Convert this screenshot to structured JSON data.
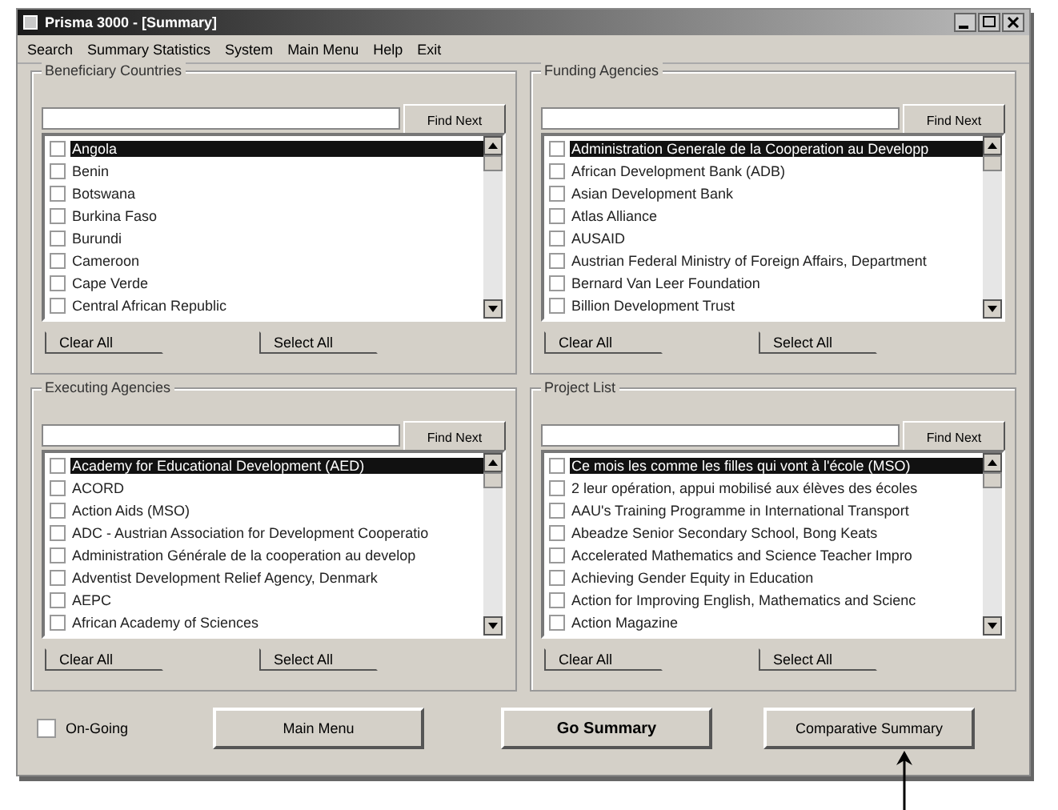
{
  "window": {
    "title": "Prisma 3000 - [Summary]"
  },
  "menu": [
    "Search",
    "Summary Statistics",
    "System",
    "Main Menu",
    "Help",
    "Exit"
  ],
  "groups": [
    {
      "title": "Beneficiary Countries",
      "find_button": "Find Next",
      "clear_button": "Clear All",
      "select_button": "Select All",
      "items": [
        {
          "label": "Angola",
          "checked": false,
          "selected": true
        },
        {
          "label": "Benin",
          "checked": false,
          "selected": false
        },
        {
          "label": "Botswana",
          "checked": false,
          "selected": false
        },
        {
          "label": "Burkina Faso",
          "checked": false,
          "selected": false
        },
        {
          "label": "Burundi",
          "checked": false,
          "selected": false
        },
        {
          "label": "Cameroon",
          "checked": false,
          "selected": false
        },
        {
          "label": "Cape Verde",
          "checked": false,
          "selected": false
        },
        {
          "label": "Central African Republic",
          "checked": false,
          "selected": false
        }
      ]
    },
    {
      "title": "Funding Agencies",
      "find_button": "Find Next",
      "clear_button": "Clear All",
      "select_button": "Select All",
      "items": [
        {
          "label": "Administration Generale de la Cooperation au Developp",
          "checked": false,
          "selected": true
        },
        {
          "label": "African Development Bank (ADB)",
          "checked": false,
          "selected": false
        },
        {
          "label": "Asian Development Bank",
          "checked": false,
          "selected": false
        },
        {
          "label": "Atlas Alliance",
          "checked": false,
          "selected": false
        },
        {
          "label": "AUSAID",
          "checked": false,
          "selected": false
        },
        {
          "label": "Austrian Federal Ministry of Foreign Affairs, Department",
          "checked": false,
          "selected": false
        },
        {
          "label": "Bernard Van Leer Foundation",
          "checked": false,
          "selected": false
        },
        {
          "label": "Billion Development Trust",
          "checked": false,
          "selected": false
        }
      ]
    },
    {
      "title": "Executing Agencies",
      "find_button": "Find Next",
      "clear_button": "Clear All",
      "select_button": "Select All",
      "items": [
        {
          "label": "Academy for Educational Development (AED)",
          "checked": false,
          "selected": true
        },
        {
          "label": "ACORD",
          "checked": false,
          "selected": false
        },
        {
          "label": "Action Aids (MSO)",
          "checked": false,
          "selected": false
        },
        {
          "label": "ADC - Austrian Association for Development Cooperatio",
          "checked": false,
          "selected": false
        },
        {
          "label": "Administration Générale de la cooperation au develop",
          "checked": false,
          "selected": false
        },
        {
          "label": "Adventist Development Relief Agency, Denmark",
          "checked": false,
          "selected": false
        },
        {
          "label": "AEPC",
          "checked": false,
          "selected": false
        },
        {
          "label": "African Academy of Sciences",
          "checked": false,
          "selected": false
        }
      ]
    },
    {
      "title": "Project List",
      "find_button": "Find Next",
      "clear_button": "Clear All",
      "select_button": "Select All",
      "items": [
        {
          "label": "Ce mois les comme les filles qui vont à l'école (MSO)",
          "checked": false,
          "selected": true
        },
        {
          "label": "2 leur opération, appui mobilisé aux élèves des écoles",
          "checked": false,
          "selected": false
        },
        {
          "label": "AAU's Training Programme in International Transport",
          "checked": false,
          "selected": false
        },
        {
          "label": "Abeadze Senior Secondary School, Bong Keats",
          "checked": false,
          "selected": false
        },
        {
          "label": "Accelerated Mathematics and Science Teacher Impro",
          "checked": false,
          "selected": false
        },
        {
          "label": "Achieving Gender Equity in Education",
          "checked": false,
          "selected": false
        },
        {
          "label": "Action for Improving English, Mathematics and Scienc",
          "checked": false,
          "selected": false
        },
        {
          "label": "Action Magazine",
          "checked": false,
          "selected": false
        }
      ]
    }
  ],
  "ongoing": {
    "label": "On-Going",
    "checked": false
  },
  "buttons": [
    "Main Menu",
    "Go Summary",
    "Comparative Summary"
  ]
}
